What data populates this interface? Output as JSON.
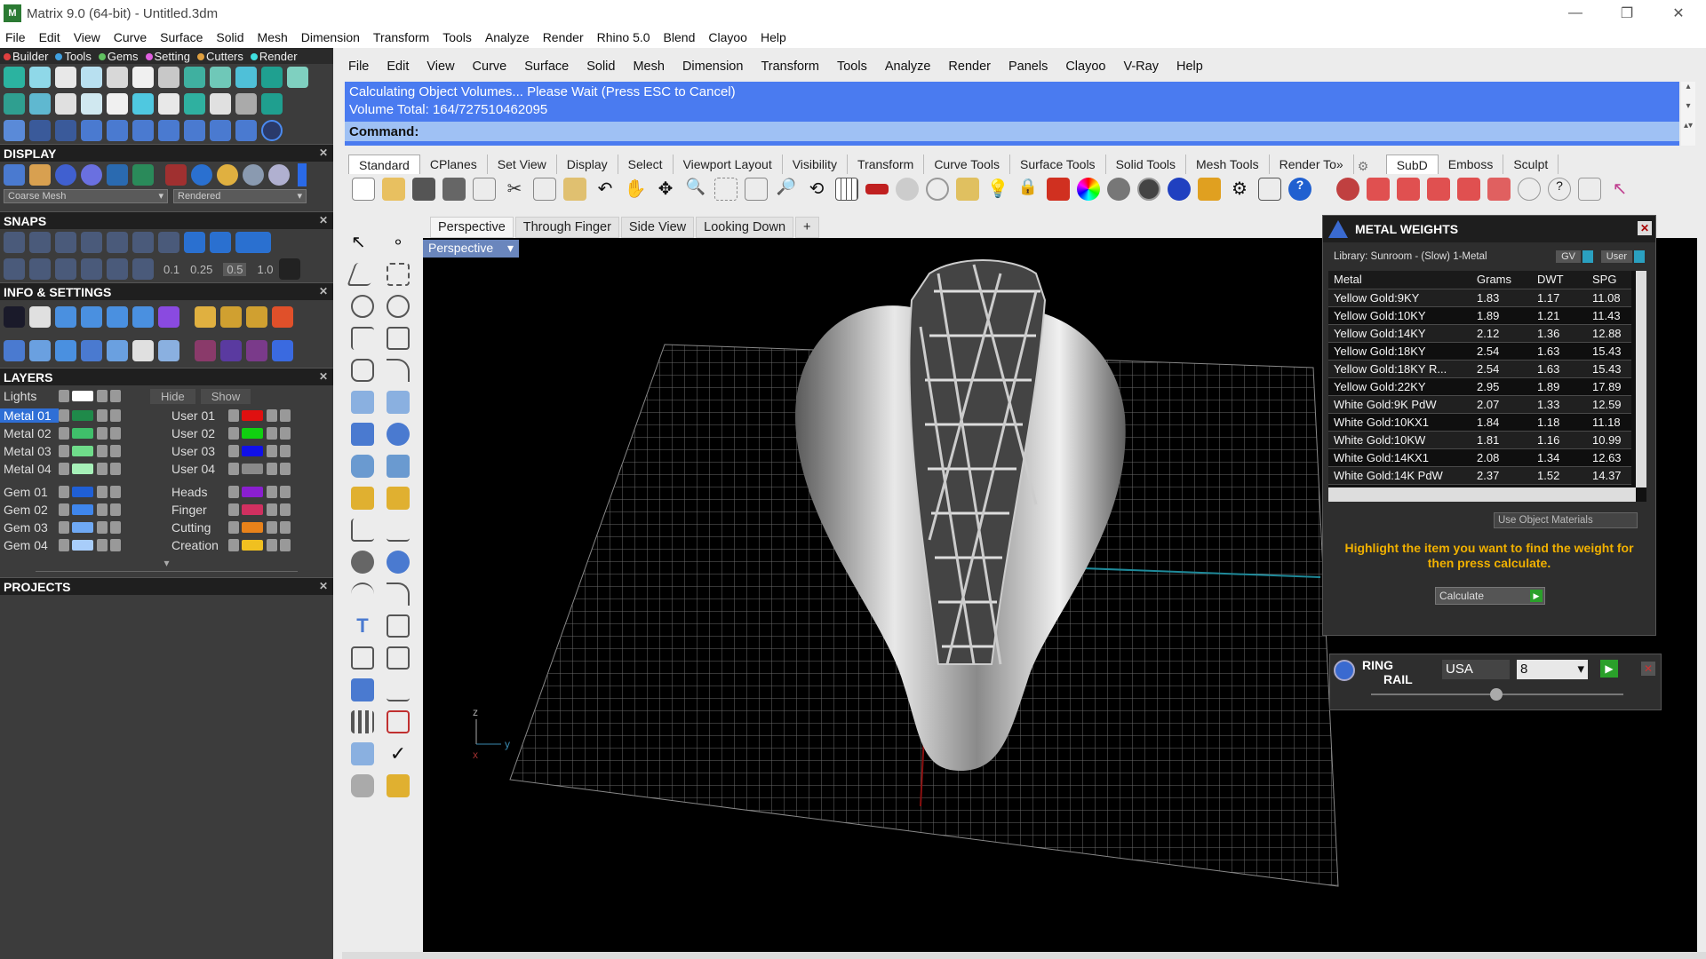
{
  "window": {
    "title": "Matrix 9.0 (64-bit) - Untitled.3dm",
    "logo": "M"
  },
  "top_menu": [
    "File",
    "Edit",
    "View",
    "Curve",
    "Surface",
    "Solid",
    "Mesh",
    "Dimension",
    "Transform",
    "Tools",
    "Analyze",
    "Render",
    "Rhino 5.0",
    "Blend",
    "Clayoo",
    "Help"
  ],
  "left_tabs": [
    {
      "label": "Builder",
      "color": "#e04040"
    },
    {
      "label": "Tools",
      "color": "#40a0e0"
    },
    {
      "label": "Gems",
      "color": "#60c060"
    },
    {
      "label": "Setting",
      "color": "#e060e0"
    },
    {
      "label": "Cutters",
      "color": "#e0a040"
    },
    {
      "label": "Render",
      "color": "#40e0e0"
    }
  ],
  "display": {
    "title": "DISPLAY",
    "mesh_select": "Coarse Mesh",
    "render_select": "Rendered"
  },
  "snaps": {
    "title": "SNAPS",
    "values": [
      "0.1",
      "0.25",
      "0.5",
      "1.0"
    ]
  },
  "info": {
    "title": "INFO & SETTINGS"
  },
  "layers": {
    "title": "LAYERS",
    "lights": "Lights",
    "hide": "Hide",
    "show": "Show",
    "left": [
      {
        "name": "Metal 01",
        "color": "#1f8a4a",
        "selected": true
      },
      {
        "name": "Metal 02",
        "color": "#3fbf6a"
      },
      {
        "name": "Metal 03",
        "color": "#6fdc8a"
      },
      {
        "name": "Metal 04",
        "color": "#a6f0b8"
      },
      {
        "name": "Gem 01",
        "color": "#1f5fd6"
      },
      {
        "name": "Gem 02",
        "color": "#3f86ec"
      },
      {
        "name": "Gem 03",
        "color": "#6fa9f4"
      },
      {
        "name": "Gem 04",
        "color": "#a8cdfa"
      }
    ],
    "right": [
      {
        "name": "User 01",
        "color": "#e01010"
      },
      {
        "name": "User 02",
        "color": "#10d010"
      },
      {
        "name": "User 03",
        "color": "#1010e8"
      },
      {
        "name": "User 04",
        "color": "#8a8a8a"
      },
      {
        "name": "Heads",
        "color": "#8a1fd0"
      },
      {
        "name": "Finger",
        "color": "#d03060"
      },
      {
        "name": "Cutting",
        "color": "#e8821a"
      },
      {
        "name": "Creation",
        "color": "#f0c020"
      }
    ]
  },
  "projects": {
    "title": "PROJECTS"
  },
  "app_menu": [
    "File",
    "Edit",
    "View",
    "Curve",
    "Surface",
    "Solid",
    "Mesh",
    "Dimension",
    "Transform",
    "Tools",
    "Analyze",
    "Render",
    "Panels",
    "Clayoo",
    "V-Ray",
    "Help"
  ],
  "command": {
    "line1": "Calculating Object Volumes... Please Wait (Press ESC to Cancel)",
    "line2": "Volume Total: 164/727510462095",
    "prompt": "Command:"
  },
  "toolbar_tabs": [
    "Standard",
    "CPlanes",
    "Set View",
    "Display",
    "Select",
    "Viewport Layout",
    "Visibility",
    "Transform",
    "Curve Tools",
    "Surface Tools",
    "Solid Tools",
    "Mesh Tools",
    "Render To»"
  ],
  "right_toolbar_tabs": [
    "SubD",
    "Emboss",
    "Sculpt"
  ],
  "view_tabs": [
    "Perspective",
    "Through Finger",
    "Side View",
    "Looking Down",
    "+"
  ],
  "viewport": {
    "label": "Perspective"
  },
  "metal_weights": {
    "title": "METAL WEIGHTS",
    "library": "Library: Sunroom - (Slow) 1-Metal",
    "gv": "GV",
    "user": "User",
    "columns": [
      "Metal",
      "Grams",
      "DWT",
      "SPG"
    ],
    "rows": [
      [
        "Yellow Gold:9KY",
        "1.83",
        "1.17",
        "11.08"
      ],
      [
        "Yellow Gold:10KY",
        "1.89",
        "1.21",
        "11.43"
      ],
      [
        "Yellow Gold:14KY",
        "2.12",
        "1.36",
        "12.88"
      ],
      [
        "Yellow Gold:18KY",
        "2.54",
        "1.63",
        "15.43"
      ],
      [
        "Yellow Gold:18KY R...",
        "2.54",
        "1.63",
        "15.43"
      ],
      [
        "Yellow Gold:22KY",
        "2.95",
        "1.89",
        "17.89"
      ],
      [
        "White Gold:9K PdW",
        "2.07",
        "1.33",
        "12.59"
      ],
      [
        "White Gold:10KX1",
        "1.84",
        "1.18",
        "11.18"
      ],
      [
        "White Gold:10KW",
        "1.81",
        "1.16",
        "10.99"
      ],
      [
        "White Gold:14KX1",
        "2.08",
        "1.34",
        "12.63"
      ],
      [
        "White Gold:14K PdW",
        "2.37",
        "1.52",
        "14.37"
      ]
    ],
    "use_object": "Use Object Materials",
    "hint": "Highlight the item you want to find the weight for then press calculate.",
    "calculate": "Calculate"
  },
  "ring_rail": {
    "title1": "RING",
    "title2": "RAIL",
    "standard": "USA",
    "size": "8"
  }
}
